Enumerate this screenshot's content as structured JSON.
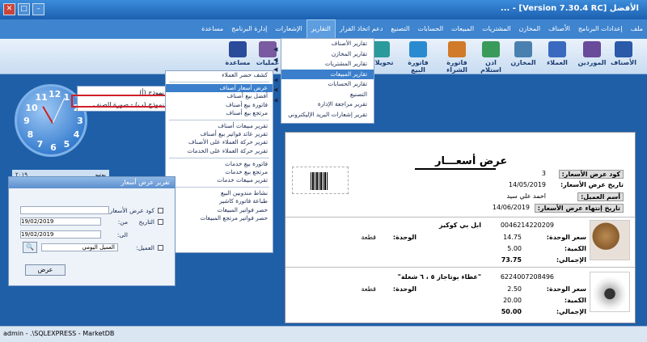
{
  "window": {
    "title": "الأفضل [Version 7.30.4 RC] - ..."
  },
  "menu": [
    "ملف",
    "إعدادات البرنامج",
    "الأصناف",
    "المخازن",
    "المشتريات",
    "المبيعات",
    "الحسابات",
    "التصنيع",
    "دعم اتخاذ القرار",
    "التقارير",
    "الإشعارات",
    "إدارة البرنامج",
    "مساعدة"
  ],
  "toolbar": [
    "الأصناف",
    "الموردين",
    "العملاء",
    "المخازن",
    "اذن استلام",
    "فاتورة الشراء",
    "فاتورة البيع",
    "تحويلات",
    "الشيكات",
    "عمليات",
    "مساعدة"
  ],
  "reports_dropdown": [
    "تقارير الأصناف",
    "تقارير المخازن",
    "تقارير المشتريات",
    "تقارير المبيعات",
    "تقارير الحسابات",
    "التصنيع",
    "تقرير مراجعة الإدارة",
    "تقرير إشعارات البريد الإليكتروني"
  ],
  "submenu": [
    "كشف حضر العملاء",
    "عرض أسعار أصناف",
    "أفضل بيع أصناف",
    "فاتورة بيع أصناف",
    "مرتجع بيع أصناف",
    "تقرير مبيعات أصناف",
    "تقرير عائد فواتير بيع أصناف",
    "تقرير حركة العملاء على الأصناف",
    "تقرير حركة العملاء على الخدمات",
    "فاتورة بيع خدمات",
    "مرتجع بيع خدمات",
    "تقرير مبيعات خدمات",
    "نشاط مندوبين البيع",
    "طباعة فاتورة كاشير",
    "حصر فواتير المبيعات",
    "حصر فواتير مرتجع المبيعات"
  ],
  "template_popup": [
    "نموذج (أ)",
    "نموذج (ب) - صورة الصنف"
  ],
  "clock": {
    "numbers": [
      "12",
      "1",
      "2",
      "3",
      "4",
      "5",
      "6",
      "7",
      "8",
      "9",
      "10",
      "11"
    ]
  },
  "date_band": {
    "year": "٢٠١٩",
    "month": "يونيو"
  },
  "dialog": {
    "title": "تقرير عرض أسعار",
    "quote_code_label": "كود عرض الأسعار:",
    "date_label": "التاريخ",
    "from_label": "من:",
    "to_label": "الى:",
    "date_from": "19/02/2019",
    "date_to": "19/02/2019",
    "customer_label": "العميل:",
    "customer_value": "العميل اليومي",
    "show_button": "عرض"
  },
  "report": {
    "title": "عرض أسعـــار",
    "quote_code_label": "كود عرض الأسعار:",
    "quote_code": "3",
    "quote_date_label": "تاريخ عرض الأسعار:",
    "quote_date": "14/05/2019",
    "customer_name_label": "أسم العميل:",
    "customer_name": "احمد علي سيد",
    "expiry_label": "تاريخ إنتهاء عرض الأسعار:",
    "expiry_date": "14/06/2019",
    "unit_label": "الوحدة:",
    "price_label": "سعر الوحدة:",
    "qty_label": "الكمية:",
    "total_label": "الإجمالي:",
    "items": [
      {
        "barcode": "0046214220209",
        "name": "ابل بي كوكيز",
        "unit": "قطعة",
        "price": "14.75",
        "qty": "5.00",
        "total": "73.75"
      },
      {
        "barcode": "6224007208496",
        "name": "\"غطاء بوتاجاز ٥ ، ٦ شعلة\"",
        "unit": "قطعة",
        "price": "2.50",
        "qty": "20.00",
        "total": "50.00"
      }
    ]
  },
  "statusbar": {
    "text": "admin - .\\SQLEXPRESS - MarketDB"
  }
}
